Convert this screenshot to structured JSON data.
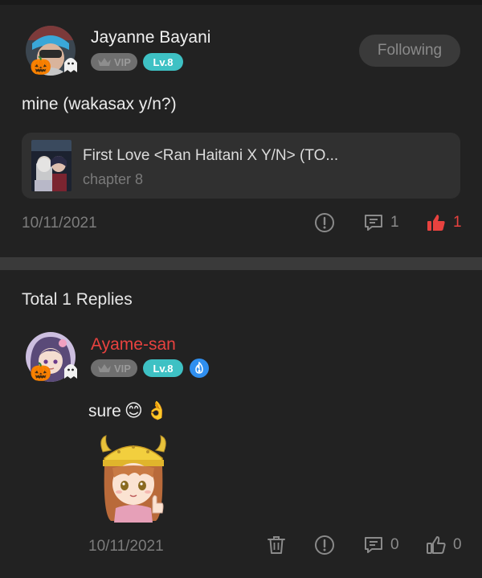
{
  "post": {
    "author": {
      "name": "Jayanne Bayani",
      "vip_label": "VIP",
      "level_label": "Lv.8"
    },
    "follow_button_label": "Following",
    "text": "mine (wakasax y/n?)",
    "book": {
      "title": "First Love <Ran Haitani X Y/N> (TO...",
      "chapter": "chapter 8"
    },
    "date": "10/11/2021",
    "comment_count": "1",
    "like_count": "1"
  },
  "replies": {
    "title": "Total 1 Replies",
    "items": [
      {
        "name": "Ayame-san",
        "vip_label": "VIP",
        "level_label": "Lv.8",
        "text": "sure",
        "emojis": [
          "😊",
          "👌"
        ],
        "date": "10/11/2021",
        "comment_count": "0",
        "like_count": "0"
      }
    ]
  },
  "icons": {
    "report": "exclamation-circle-icon",
    "comment": "comment-bubble-icon",
    "like": "thumbs-up-icon",
    "delete": "trash-icon",
    "verified": "verified-flame-icon",
    "vip": "crown-icon"
  },
  "colors": {
    "background": "#222222",
    "accent_red": "#e8423f",
    "level_badge": "#3ec1c4",
    "vip_badge": "#6f6f6f",
    "verified_badge": "#2f8ff0"
  }
}
